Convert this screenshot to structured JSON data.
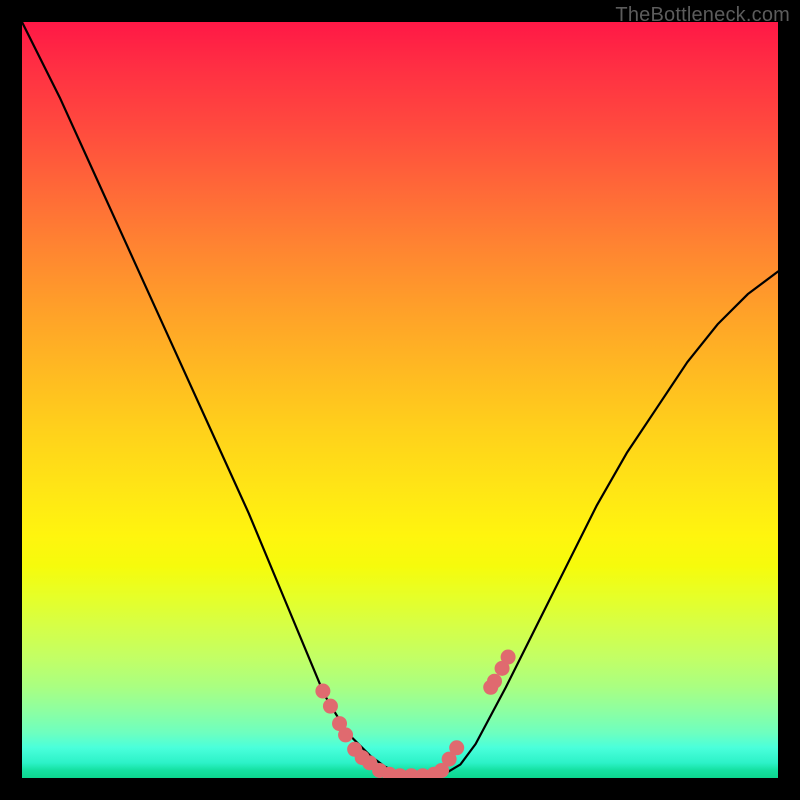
{
  "watermark": "TheBottleneck.com",
  "chart_data": {
    "type": "line",
    "title": "",
    "xlabel": "",
    "ylabel": "",
    "xlim": [
      0,
      1
    ],
    "ylim": [
      0,
      1
    ],
    "grid": false,
    "series": [
      {
        "name": "curve",
        "x": [
          0.0,
          0.05,
          0.1,
          0.15,
          0.2,
          0.25,
          0.3,
          0.35,
          0.4,
          0.43,
          0.46,
          0.48,
          0.5,
          0.52,
          0.54,
          0.56,
          0.58,
          0.6,
          0.64,
          0.68,
          0.72,
          0.76,
          0.8,
          0.84,
          0.88,
          0.92,
          0.96,
          1.0
        ],
        "values": [
          1.0,
          0.9,
          0.79,
          0.68,
          0.57,
          0.46,
          0.35,
          0.23,
          0.11,
          0.06,
          0.03,
          0.015,
          0.005,
          0.003,
          0.003,
          0.006,
          0.018,
          0.045,
          0.12,
          0.2,
          0.28,
          0.36,
          0.43,
          0.49,
          0.55,
          0.6,
          0.64,
          0.67
        ]
      }
    ],
    "markers": {
      "name": "dots",
      "color": "#e06a6f",
      "points": [
        {
          "x": 0.398,
          "y": 0.115
        },
        {
          "x": 0.408,
          "y": 0.095
        },
        {
          "x": 0.42,
          "y": 0.072
        },
        {
          "x": 0.428,
          "y": 0.057
        },
        {
          "x": 0.44,
          "y": 0.038
        },
        {
          "x": 0.45,
          "y": 0.027
        },
        {
          "x": 0.46,
          "y": 0.02
        },
        {
          "x": 0.473,
          "y": 0.01
        },
        {
          "x": 0.486,
          "y": 0.005
        },
        {
          "x": 0.5,
          "y": 0.003
        },
        {
          "x": 0.515,
          "y": 0.003
        },
        {
          "x": 0.53,
          "y": 0.003
        },
        {
          "x": 0.545,
          "y": 0.005
        },
        {
          "x": 0.555,
          "y": 0.01
        },
        {
          "x": 0.565,
          "y": 0.025
        },
        {
          "x": 0.575,
          "y": 0.04
        },
        {
          "x": 0.62,
          "y": 0.12
        },
        {
          "x": 0.625,
          "y": 0.128
        },
        {
          "x": 0.635,
          "y": 0.145
        },
        {
          "x": 0.643,
          "y": 0.16
        }
      ]
    }
  }
}
